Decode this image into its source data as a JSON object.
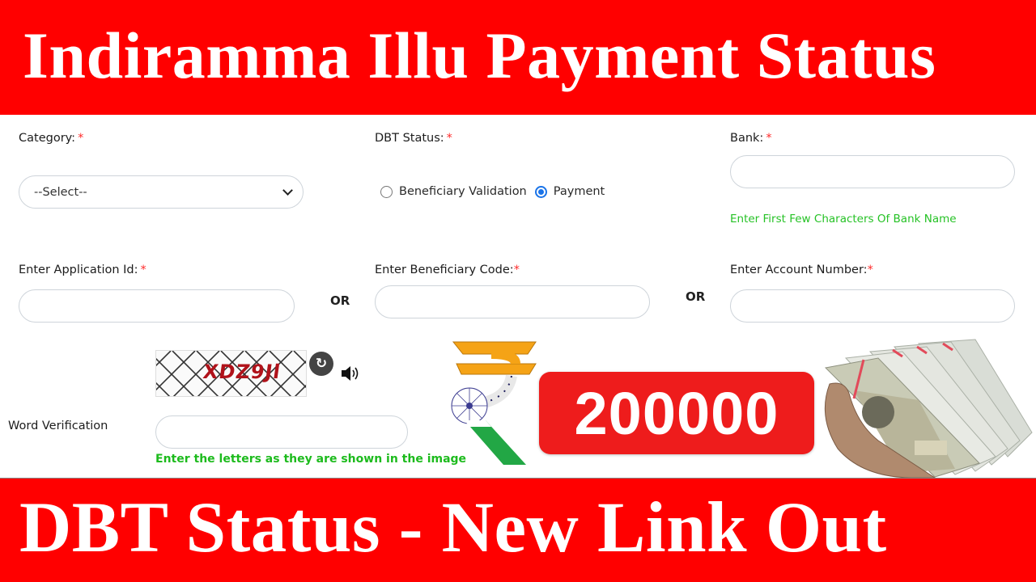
{
  "header": {
    "title": "Indiramma Illu Payment Status"
  },
  "footer": {
    "title": "DBT Status - New Link Out"
  },
  "form": {
    "category": {
      "label": "Category:",
      "required_mark": "*",
      "selected": "--Select--"
    },
    "dbt_status": {
      "label": "DBT Status:",
      "required_mark": "*",
      "options": [
        {
          "label": "Beneficiary Validation",
          "checked": false
        },
        {
          "label": "Payment",
          "checked": true
        }
      ]
    },
    "bank": {
      "label": "Bank:",
      "required_mark": "*",
      "value": "",
      "hint": "Enter First Few Characters Of Bank Name"
    },
    "application_id": {
      "label": "Enter Application Id:",
      "required_mark": "*",
      "value": ""
    },
    "beneficiary_code": {
      "label": "Enter Beneficiary Code:",
      "required_mark": "*",
      "value": ""
    },
    "account_number": {
      "label": "Enter Account Number:",
      "required_mark": "*",
      "value": ""
    },
    "or_separator": "OR",
    "captcha": {
      "text": "XDZ9Jl",
      "refresh_icon": "refresh-icon",
      "audio_icon": "speaker-icon"
    },
    "word_verification": {
      "label": "Word Verification",
      "value": "",
      "hint": "Enter the letters as they are shown in the image"
    }
  },
  "promo": {
    "amount": "200000",
    "currency_icon": "rupee-icon",
    "image": "cash-in-hand"
  },
  "colors": {
    "banner": "#ff0000",
    "hint_green": "#26c226",
    "required_red": "#ff2b2b",
    "radio_blue": "#1a73e8",
    "badge_red": "#ee1c1c"
  }
}
